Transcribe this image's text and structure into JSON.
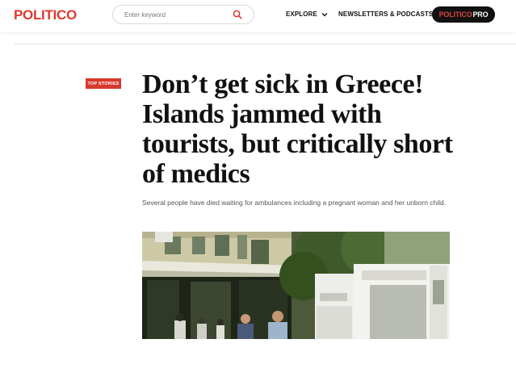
{
  "header": {
    "logo": "POLITICO",
    "search": {
      "placeholder": "Enter keyword",
      "value": ""
    },
    "nav": [
      {
        "label": "EXPLORE",
        "icon": "chevron-down-icon"
      },
      {
        "label": "NEWSLETTERS & PODCASTS",
        "icon": "chevron-down-icon"
      }
    ],
    "pro_button": {
      "brand": "POLITICO",
      "suffix": "PRO"
    },
    "icons": {
      "search": "search-icon"
    }
  },
  "article": {
    "badge": "TOP STORIES",
    "headline": "Don’t get sick in Greece! Islands jammed with tourists, but critically short of medics",
    "dek": "Several people have died waiting for ambulances including a pregnant woman and her unborn child."
  },
  "colors": {
    "brand_red": "#dc3a2f",
    "badge_red": "#d73a2e",
    "pro_bg": "#111111"
  }
}
